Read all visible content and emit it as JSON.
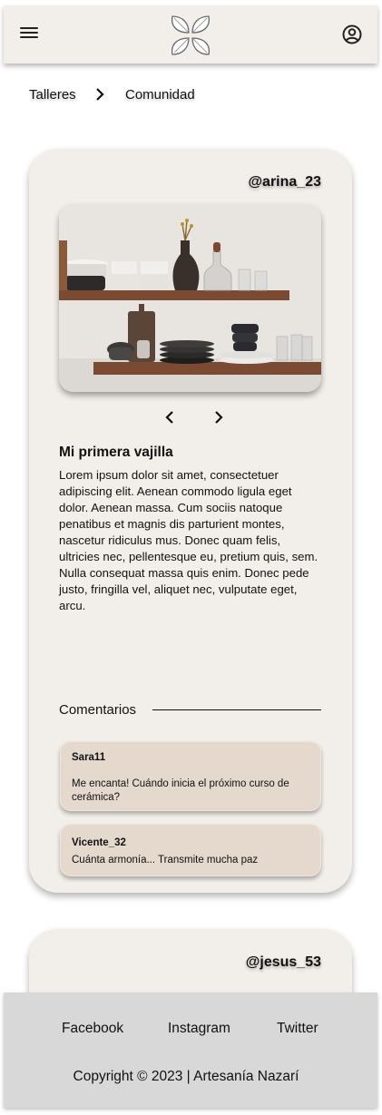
{
  "header": {
    "logo_icon": "leaf-logo-icon",
    "menu_icon": "hamburger-menu-icon",
    "account_icon": "user-circle-icon"
  },
  "breadcrumb": {
    "items": [
      "Talleres",
      "Comunidad"
    ],
    "separator_icon": "chevron-right-icon"
  },
  "posts": [
    {
      "username": "@arina_23",
      "image": "kitchen-shelves-with-ceramics",
      "title": "Mi primera vajilla",
      "body": "Lorem ipsum dolor sit amet, consectetuer adipiscing elit. Aenean commodo ligula eget dolor. Aenean massa. Cum sociis natoque penatibus et magnis dis parturient montes, nascetur ridiculus mus. Donec quam felis, ultricies nec, pellentesque eu, pretium quis, sem. Nulla consequat massa quis enim. Donec pede justo, fringilla vel, aliquet nec, vulputate eget, arcu.",
      "comments_label": "Comentarios",
      "comments": [
        {
          "user": "Sara11",
          "text": "Me encanta! Cuándo inicia el próximo curso de cerámica?"
        },
        {
          "user": "Vicente_32",
          "text": "Cuánta armonía... Transmite mucha paz"
        }
      ]
    },
    {
      "username": "@jesus_53"
    }
  ],
  "footer": {
    "links": [
      "Facebook",
      "Instagram",
      "Twitter"
    ],
    "copyright": "Copyright © 2023 | Artesanía Nazarí"
  },
  "colors": {
    "header_bg": "#f2efea",
    "card_bg": "#f2efea",
    "comment_bg": "#e5d9ce",
    "footer_bg": "#d8d8d8"
  }
}
